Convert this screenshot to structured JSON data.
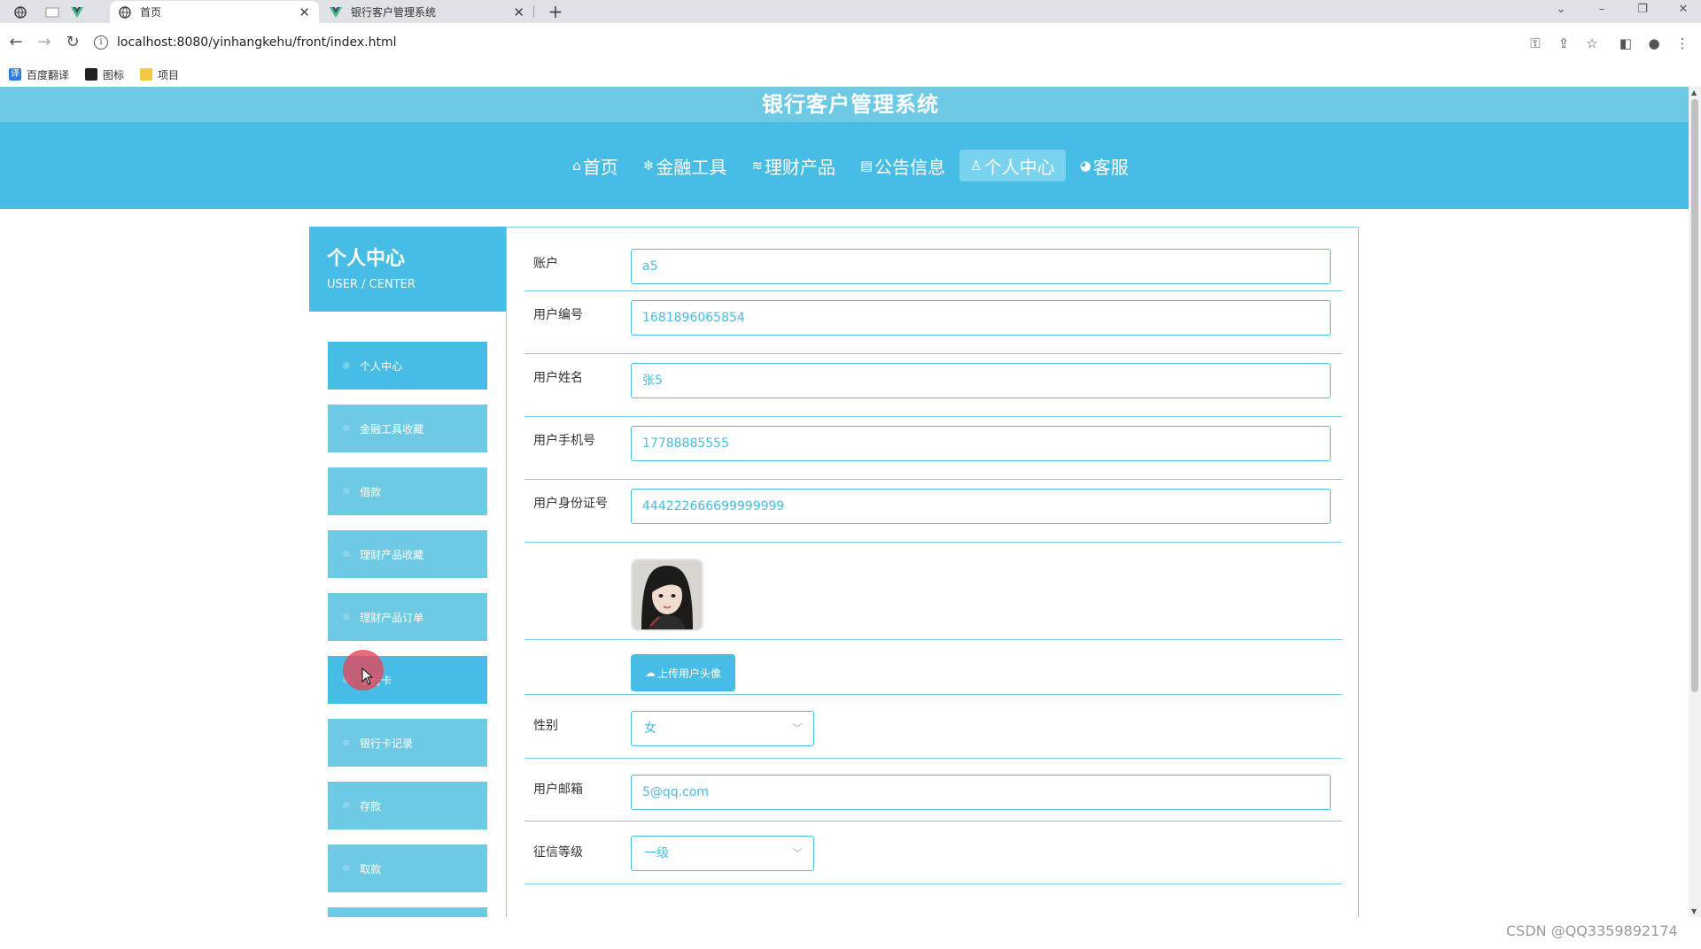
{
  "browser": {
    "tabs": [
      {
        "title": "首页",
        "active": true
      },
      {
        "title": "银行客户管理系统",
        "active": false
      }
    ],
    "url": "localhost:8080/yinhangkehu/front/index.html",
    "bookmarks": [
      "百度翻译",
      "图标",
      "项目"
    ]
  },
  "site": {
    "title": "银行客户管理系统",
    "nav": [
      {
        "label": "首页",
        "icon": "⌂"
      },
      {
        "label": "金融工具",
        "icon": "❄"
      },
      {
        "label": "理财产品",
        "icon": "≋"
      },
      {
        "label": "公告信息",
        "icon": "▤"
      },
      {
        "label": "个人中心",
        "icon": "♙",
        "active": true
      },
      {
        "label": "客服",
        "icon": "◕"
      }
    ]
  },
  "sidebar": {
    "title": "个人中心",
    "subtitle": "USER / CENTER",
    "items": [
      {
        "label": "个人中心",
        "active": true
      },
      {
        "label": "金融工具收藏"
      },
      {
        "label": "借款"
      },
      {
        "label": "理财产品收藏"
      },
      {
        "label": "理财产品订单"
      },
      {
        "label": "银行卡",
        "active": true
      },
      {
        "label": "银行卡记录"
      },
      {
        "label": "存款"
      },
      {
        "label": "取款"
      }
    ]
  },
  "form": {
    "account_label": "账户",
    "account_value": "a5",
    "user_no_label": "用户编号",
    "user_no_value": "1681896065854",
    "name_label": "用户姓名",
    "name_value": "张5",
    "phone_label": "用户手机号",
    "phone_value": "17788885555",
    "idcard_label": "用户身份证号",
    "idcard_value": "444222666699999999",
    "upload_label": "上传用户头像",
    "gender_label": "性别",
    "gender_value": "女",
    "email_label": "用户邮箱",
    "email_value": "5@qq.com",
    "credit_label": "征信等级",
    "credit_value": "一级"
  },
  "watermark": "CSDN @QQ3359892174"
}
